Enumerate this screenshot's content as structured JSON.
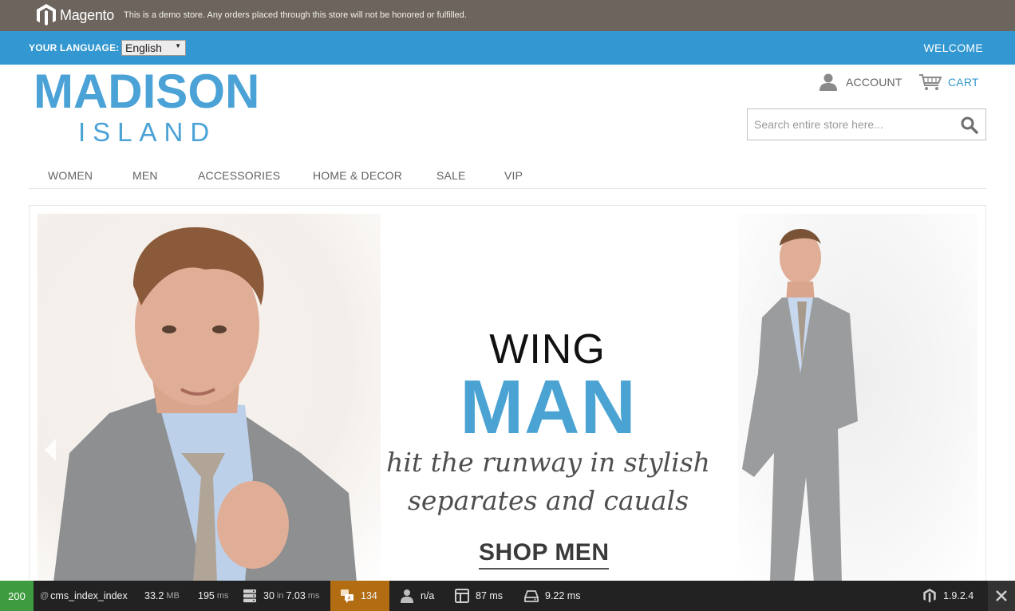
{
  "demo_bar": {
    "logo_text": "Magento",
    "notice": "This is a demo store. Any orders placed through this store will not be honored or fulfilled."
  },
  "language_bar": {
    "label": "YOUR LANGUAGE:",
    "selected_language": "English",
    "welcome": "WELCOME"
  },
  "header": {
    "logo_main": "MADISON",
    "logo_sub": "ISLAND",
    "account_label": "ACCOUNT",
    "cart_label": "CART",
    "search_placeholder": "Search entire store here..."
  },
  "nav": {
    "items": [
      {
        "label": "WOMEN"
      },
      {
        "label": "MEN"
      },
      {
        "label": "ACCESSORIES"
      },
      {
        "label": "HOME & DECOR"
      },
      {
        "label": "SALE"
      },
      {
        "label": "VIP"
      }
    ]
  },
  "banner": {
    "headline_1": "WING",
    "headline_2": "MAN",
    "tagline_1": "hit the runway in stylish",
    "tagline_2": "separates and cauals",
    "cta": "SHOP MEN"
  },
  "debug_bar": {
    "status_code": "200",
    "route": "cms_index_index",
    "memory_value": "33.2",
    "memory_unit": "MB",
    "time_value": "195",
    "time_unit": "ms",
    "queries_count": "30",
    "queries_in": "in",
    "queries_time": "7.03",
    "queries_unit": "ms",
    "translations": "134",
    "customer": "n/a",
    "layout_time": "87 ms",
    "cache_time": "9.22 ms",
    "version": "1.9.2.4"
  },
  "colors": {
    "brand_blue": "#3397d1",
    "demo_bar": "#6d655d",
    "status_ok": "#3f9b3f",
    "translations_highlight": "#b26c12"
  }
}
